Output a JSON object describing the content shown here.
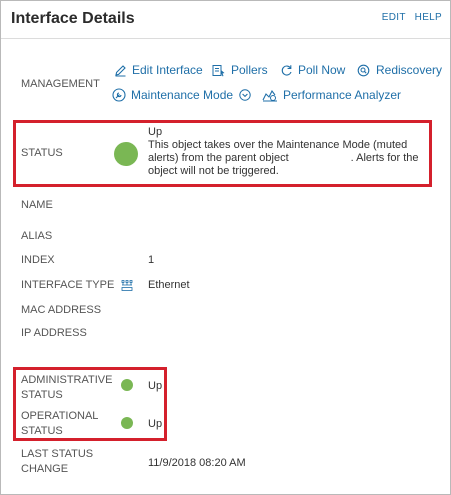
{
  "header": {
    "title": "Interface Details",
    "edit_label": "EDIT",
    "help_label": "HELP"
  },
  "management": {
    "label": "MANAGEMENT",
    "actions": {
      "edit_interface": "Edit Interface",
      "pollers": "Pollers",
      "poll_now": "Poll Now",
      "rediscovery": "Rediscovery",
      "maintenance_mode": "Maintenance Mode",
      "performance_analyzer": "Performance Analyzer"
    }
  },
  "status": {
    "label": "STATUS",
    "state": "Up",
    "message_part1": "This object takes over the Maintenance Mode (muted alerts) from the parent object",
    "message_part2": ". Alerts for the object will not be triggered.",
    "color": "#7ab754"
  },
  "fields": {
    "name_label": "NAME",
    "alias_label": "ALIAS",
    "index_label": "INDEX",
    "index_value": "1",
    "interface_type_label": "INTERFACE TYPE",
    "interface_type_value": "Ethernet",
    "mac_label": "MAC ADDRESS",
    "ip_label": "IP ADDRESS"
  },
  "admin_status": {
    "label_line1": "ADMINISTRATIVE",
    "label_line2": "STATUS",
    "value": "Up"
  },
  "oper_status": {
    "label_line1": "OPERATIONAL",
    "label_line2": "STATUS",
    "value": "Up"
  },
  "last_change": {
    "label_line1": "LAST STATUS",
    "label_line2": "CHANGE",
    "value": "11/9/2018 08:20 AM"
  },
  "colors": {
    "accent_link": "#1f6fa8",
    "highlight_red": "#d4202c",
    "status_green": "#7ab754"
  }
}
